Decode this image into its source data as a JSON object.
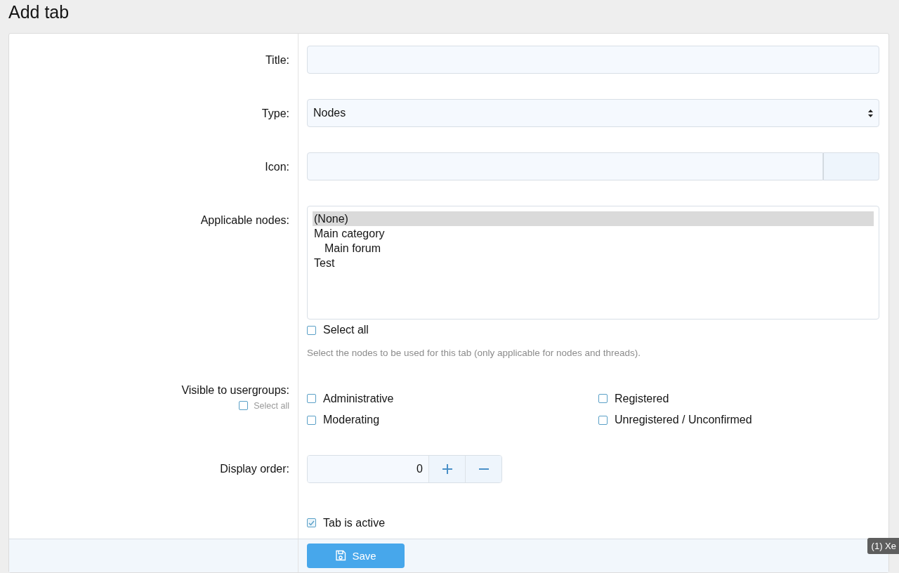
{
  "page_title": "Add tab",
  "fields": [
    {
      "kind": "text",
      "label": "Title:"
    },
    {
      "kind": "select",
      "label": "Type:",
      "value": "Nodes"
    },
    {
      "kind": "icon",
      "label": "Icon:"
    },
    {
      "kind": "listbox",
      "label": "Applicable nodes:",
      "options": [
        {
          "label": "(None)",
          "selected": true
        },
        {
          "label": "Main category",
          "selected": false,
          "children": [
            {
              "label": "Main forum",
              "selected": false
            }
          ]
        },
        {
          "label": "Test",
          "selected": false
        }
      ],
      "select_all": {
        "label": "Select all",
        "checked": false
      },
      "hint": "Select the nodes to be used for this tab (only applicable for nodes and threads)."
    },
    {
      "kind": "checkgroup",
      "label": "Visible to usergroups:",
      "select_all": {
        "label": "Select all",
        "checked": false
      },
      "options": [
        {
          "label": "Administrative",
          "checked": false
        },
        {
          "label": "Registered",
          "checked": false
        },
        {
          "label": "Moderating",
          "checked": false
        },
        {
          "label": "Unregistered / Unconfirmed",
          "checked": false
        }
      ]
    },
    {
      "kind": "number",
      "label": "Display order:",
      "value": "0"
    },
    {
      "kind": "checkbox",
      "option": {
        "label": "Tab is active",
        "checked": true
      }
    }
  ],
  "save_button": {
    "label": "Save"
  },
  "tooltip": "(1) Xe"
}
